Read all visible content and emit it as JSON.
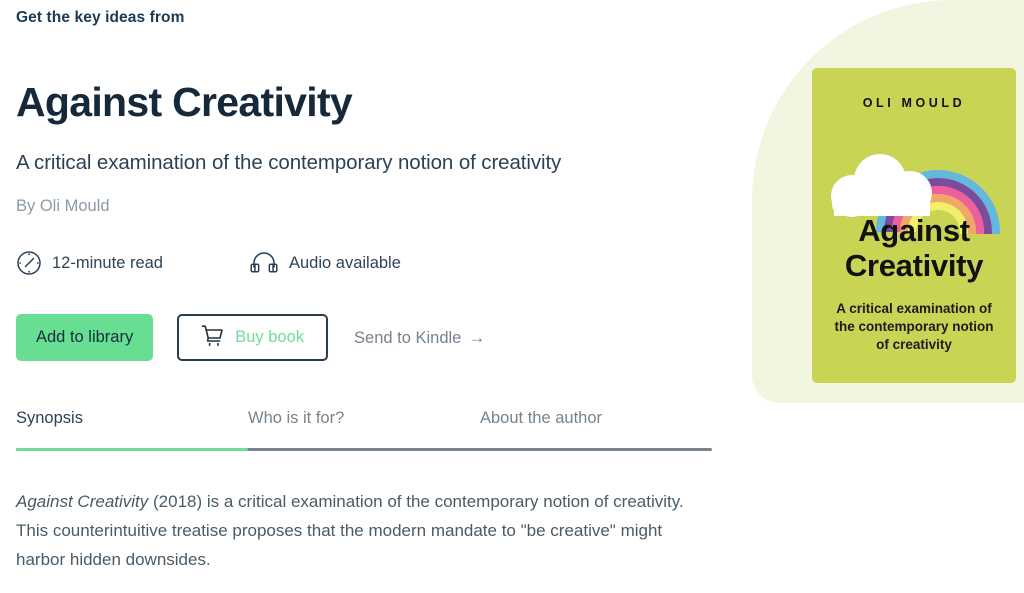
{
  "header": {
    "eyebrow": "Get the key ideas from"
  },
  "book": {
    "title": "Against Creativity",
    "subtitle": "A critical examination of the contemporary notion of creativity",
    "byline": "By Oli Mould"
  },
  "meta": [
    {
      "icon": "clock-icon",
      "label": "12-minute read"
    },
    {
      "icon": "headphones-icon",
      "label": "Audio available"
    }
  ],
  "actions": {
    "add_to_library_label": "Add to library",
    "buy_book_label": "Buy book",
    "buy_book_icon": "shopping-cart-icon",
    "send_to_kindle_label": "Send to Kindle",
    "send_to_kindle_arrow": "→"
  },
  "tabs": [
    {
      "label": "Synopsis",
      "active": true
    },
    {
      "label": "Who is it for?",
      "active": false
    },
    {
      "label": "About the author",
      "active": false
    }
  ],
  "synopsis": {
    "title_italic": "Against Creativity",
    "rest": " (2018) is a critical examination of the contemporary notion of creativity. This counterintuitive treatise proposes that the modern mandate to \"be creative\" might harbor hidden downsides."
  },
  "cover": {
    "author": "OLI MOULD",
    "title_line1": "Against",
    "title_line2": "Creativity",
    "subtitle": "A critical examination of the contemporary notion of creativity",
    "background_color": "#c9d455",
    "blob_color": "#f2f5e0",
    "rainbow_colors": [
      "#f2f06a",
      "#f0a868",
      "#ef5f9c",
      "#7b4c9e",
      "#63b8e0"
    ],
    "cloud_color": "#ffffff"
  },
  "colors": {
    "accent_green": "#68de92",
    "text_dark": "#16293a",
    "text_muted": "#8d9aa5",
    "tab_rail": "#7a828d"
  }
}
